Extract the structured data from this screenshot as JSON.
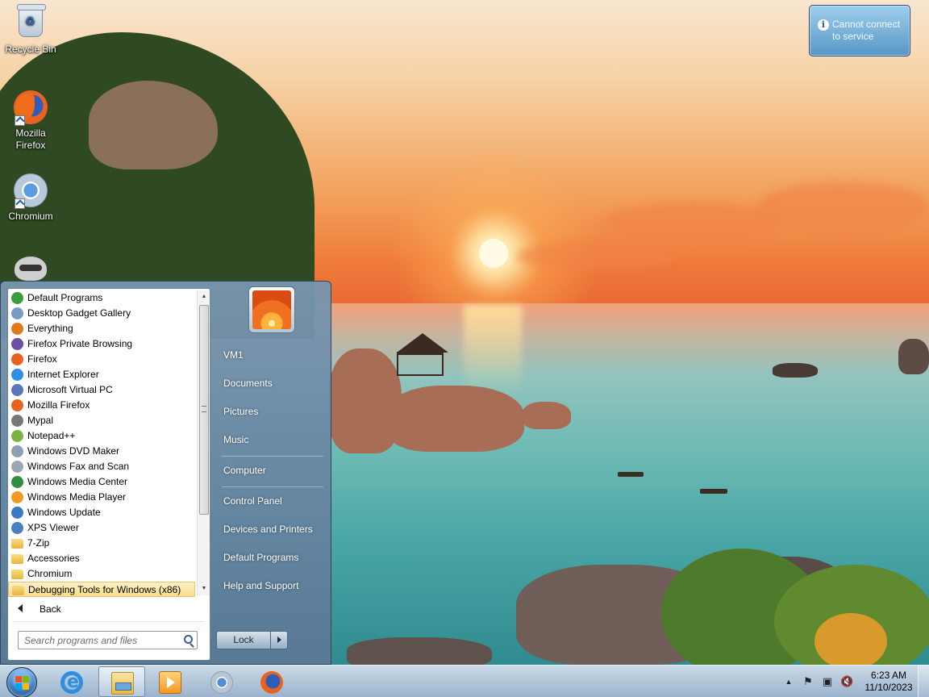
{
  "desktop": {
    "icons": [
      {
        "label": "Recycle Bin",
        "icon": "recycle-bin-icon"
      },
      {
        "label": "Mozilla Firefox",
        "icon": "firefox-icon"
      },
      {
        "label": "Chromium",
        "icon": "chromium-icon"
      },
      {
        "label": "",
        "icon": "mypal-raccoon-icon"
      }
    ]
  },
  "notification": {
    "text": "Cannot connect to service",
    "icon": "info-icon"
  },
  "start_menu": {
    "programs": [
      {
        "label": "Default Programs",
        "icon": "default-programs-icon",
        "color": "#3d9b3d"
      },
      {
        "label": "Desktop Gadget Gallery",
        "icon": "gadget-gallery-icon",
        "color": "#7a9cc4"
      },
      {
        "label": "Everything",
        "icon": "everything-search-icon",
        "color": "#e07b1c"
      },
      {
        "label": "Firefox Private Browsing",
        "icon": "firefox-private-icon",
        "color": "#6b4fa0"
      },
      {
        "label": "Firefox",
        "icon": "firefox-icon",
        "color": "#e8631f"
      },
      {
        "label": "Internet Explorer",
        "icon": "internet-explorer-icon",
        "color": "#2c8fe2"
      },
      {
        "label": "Microsoft Virtual PC",
        "icon": "virtual-pc-icon",
        "color": "#5a77b6"
      },
      {
        "label": "Mozilla Firefox",
        "icon": "firefox-icon",
        "color": "#e8631f"
      },
      {
        "label": "Mypal",
        "icon": "mypal-icon",
        "color": "#777777"
      },
      {
        "label": "Notepad++",
        "icon": "notepad-plus-plus-icon",
        "color": "#7cb342"
      },
      {
        "label": "Windows DVD Maker",
        "icon": "dvd-maker-icon",
        "color": "#8d9fb3"
      },
      {
        "label": "Windows Fax and Scan",
        "icon": "fax-scan-icon",
        "color": "#9aa7b4"
      },
      {
        "label": "Windows Media Center",
        "icon": "media-center-icon",
        "color": "#2f8f3f"
      },
      {
        "label": "Windows Media Player",
        "icon": "media-player-icon",
        "color": "#f39a24"
      },
      {
        "label": "Windows Update",
        "icon": "windows-update-icon",
        "color": "#3b7ac6"
      },
      {
        "label": "XPS Viewer",
        "icon": "xps-viewer-icon",
        "color": "#4a7fc0"
      },
      {
        "label": "7-Zip",
        "icon": "folder-icon",
        "color": "#e9b948"
      },
      {
        "label": "Accessories",
        "icon": "folder-icon",
        "color": "#e9b948"
      },
      {
        "label": "Chromium",
        "icon": "folder-icon",
        "color": "#e9b948"
      },
      {
        "label": "Debugging Tools for Windows (x86)",
        "icon": "folder-icon",
        "color": "#e9b948"
      }
    ],
    "selected_program": "Debugging Tools for Windows (x86)",
    "back_label": "Back",
    "search_placeholder": "Search programs and files",
    "user_name": "VM1",
    "right_links": [
      "VM1",
      "Documents",
      "Pictures",
      "Music",
      "Computer",
      "Control Panel",
      "Devices and Printers",
      "Default Programs",
      "Help and Support"
    ],
    "lock_label": "Lock"
  },
  "taskbar": {
    "pinned": [
      {
        "name": "internet-explorer",
        "icon": "internet-explorer-icon"
      },
      {
        "name": "windows-explorer",
        "icon": "folder-explorer-icon",
        "active": true
      },
      {
        "name": "media-player",
        "icon": "media-player-icon"
      },
      {
        "name": "chromium",
        "icon": "chromium-icon"
      },
      {
        "name": "firefox",
        "icon": "firefox-icon"
      }
    ],
    "tray_icons": [
      "show-hidden-icons-icon",
      "action-center-flag-icon",
      "network-icon",
      "volume-muted-icon"
    ],
    "clock_time": "6:23 AM",
    "clock_date": "11/10/2023"
  },
  "colors": {
    "accent": "#5a7896",
    "selection": "#f9dd8a"
  }
}
